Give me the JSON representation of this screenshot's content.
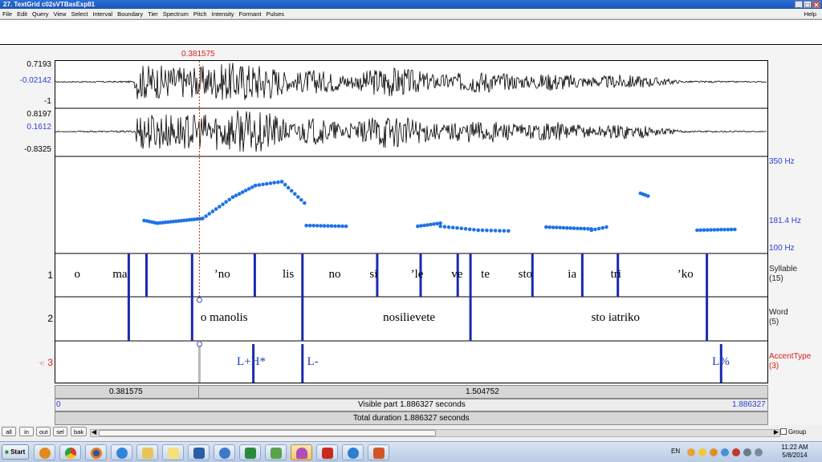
{
  "window": {
    "title": "27. TextGrid c02sVTBasExp81",
    "controls": [
      "_",
      "□",
      "✕"
    ]
  },
  "menu": {
    "items": [
      "File",
      "Edit",
      "Query",
      "View",
      "Select",
      "Interval",
      "Boundary",
      "Tier",
      "Spectrum",
      "Pitch",
      "Intensity",
      "Formant",
      "Pulses"
    ],
    "help": "Help"
  },
  "cursor": {
    "time_label": "0.381575",
    "time": 0.381575
  },
  "waveform": {
    "channel1": {
      "max": "0.7193",
      "value": "-0.02142",
      "min": "-1"
    },
    "channel2": {
      "max": "0.8197",
      "value": "0.1612",
      "min": "-0.8325"
    }
  },
  "pitch": {
    "top_label": "350 Hz",
    "mid_label": "181.4 Hz",
    "bottom_label": "100 Hz",
    "range_hz": [
      100,
      350
    ]
  },
  "tiers": [
    {
      "number": "1",
      "name": "Syllable",
      "count": "(15)",
      "color": "#000000",
      "intervals": [
        {
          "text": "o",
          "t": 0.058
        },
        {
          "text": "ma",
          "t": 0.171
        },
        {
          "text": "’no",
          "t": 0.442
        },
        {
          "text": "lis",
          "t": 0.617
        },
        {
          "text": "no",
          "t": 0.74
        },
        {
          "text": "si",
          "t": 0.843
        },
        {
          "text": "’le",
          "t": 0.958
        },
        {
          "text": "ve",
          "t": 1.064
        },
        {
          "text": "te",
          "t": 1.139
        },
        {
          "text": "sto",
          "t": 1.245
        },
        {
          "text": "ia",
          "t": 1.369
        },
        {
          "text": "tri",
          "t": 1.485
        },
        {
          "text": "’ko",
          "t": 1.669
        }
      ]
    },
    {
      "number": "2",
      "name": "Word",
      "count": "(5)",
      "color": "#000000",
      "intervals": [
        {
          "text": "o manolis",
          "t": 0.447
        },
        {
          "text": "nosilievete",
          "t": 0.937
        },
        {
          "text": "sto iatriko",
          "t": 1.484
        }
      ]
    },
    {
      "number": "3",
      "name": "AccentType",
      "count": "(3)",
      "color": "#d4201b",
      "points": [
        {
          "text": "L+H*",
          "t": 0.519
        },
        {
          "text": "L-",
          "t": 0.682
        },
        {
          "text": "L%",
          "t": 1.763
        }
      ]
    }
  ],
  "selection_bar": {
    "left": "0.381575",
    "right": "1.504752"
  },
  "visible_bar": {
    "start": "0",
    "text": "Visible part 1.886327 seconds",
    "end": "1.886327"
  },
  "total_bar": {
    "text": "Total duration 1.886327 seconds"
  },
  "duration": 1.886327,
  "buttons": [
    "all",
    "in",
    "out",
    "sel",
    "bak"
  ],
  "group_label": "Group",
  "taskbar": {
    "start": "Start",
    "lang": "EN",
    "time": "11:22 AM",
    "date": "5/8/2014"
  },
  "colors": {
    "boundary": "#1a2ab0",
    "pitch_dot": "#1e73e8",
    "cursor": "#d4201b",
    "accent_text": "#2338b8"
  }
}
